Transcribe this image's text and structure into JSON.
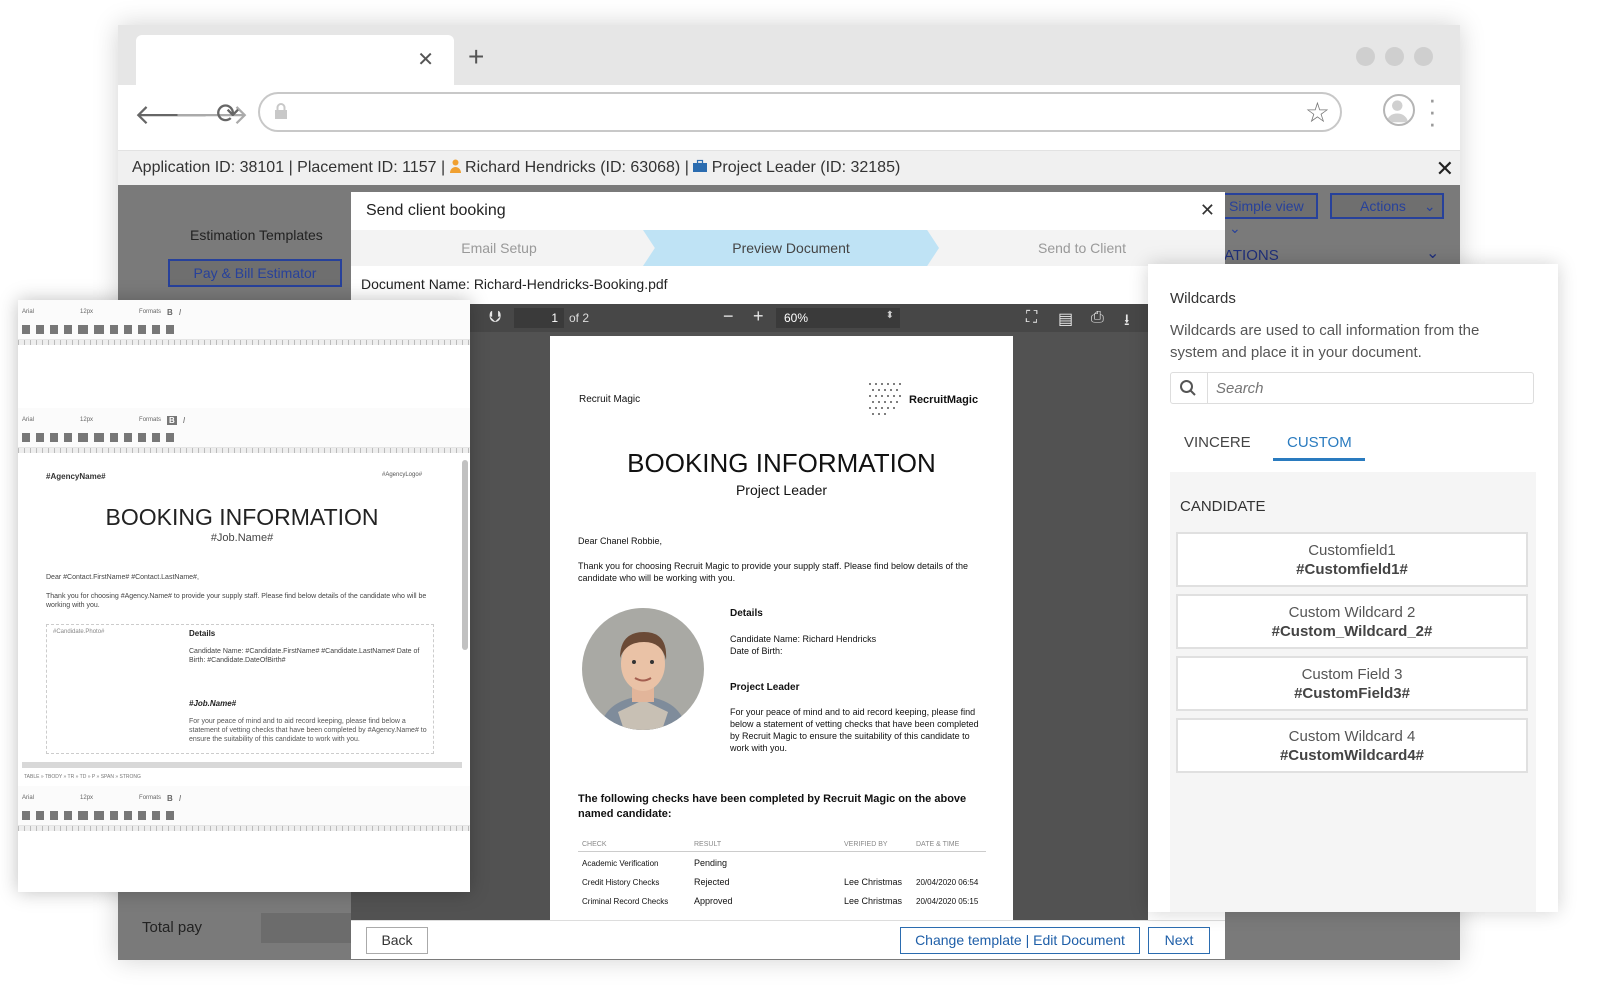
{
  "app": {
    "context_bar": {
      "application": "Application ID: 38101",
      "placement": "Placement ID: 1157",
      "candidate": "Richard Hendricks (ID: 63068)",
      "job": "Project Leader (ID: 32185)",
      "sep": "|"
    },
    "left": {
      "estimation_templates": "Estimation Templates",
      "pay_bill_estimator": "Pay & Bill Estimator",
      "total_pay": "Total pay"
    },
    "right": {
      "simple_view": "Simple view",
      "actions": "Actions",
      "section": "ATIONS"
    }
  },
  "modal": {
    "title": "Send client booking",
    "steps": [
      "Email Setup",
      "Preview Document",
      "Send to Client"
    ],
    "document_name": "Document Name: Richard-Hendricks-Booking.pdf",
    "viewer": {
      "page": "1",
      "page_of": "of 2",
      "zoom": "60%"
    },
    "footer": {
      "back": "Back",
      "change": "Change template | Edit Document",
      "next": "Next"
    }
  },
  "pdf": {
    "company": "Recruit Magic",
    "logo_text": "RecruitMagic",
    "title": "BOOKING INFORMATION",
    "subtitle": "Project Leader",
    "dear": "Dear Chanel Robbie,",
    "thanks": "Thank you for choosing Recruit Magic to provide your supply staff. Please find below details of the candidate who will be working with you.",
    "details_h": "Details",
    "details_name": "Candidate Name: Richard Hendricks",
    "details_dob": "Date of Birth:",
    "job_h": "Project Leader",
    "job_text": "For your peace of mind and to aid record keeping, please find below a statement of vetting checks that have been completed by Recruit Magic to ensure the suitability of this candidate to work with you.",
    "checks_h": "The following checks have been completed by Recruit Magic on the above named candidate:",
    "table": {
      "headers": [
        "CHECK",
        "RESULT",
        "VERIFIED BY",
        "DATE & TIME"
      ],
      "rows": [
        [
          "Academic Verification",
          "Pending",
          "",
          ""
        ],
        [
          "Credit History Checks",
          "Rejected",
          "Lee Christmas",
          "20/04/2020 06:54"
        ],
        [
          "Criminal Record Checks",
          "Approved",
          "Lee Christmas",
          "20/04/2020 05:15"
        ]
      ]
    }
  },
  "editor": {
    "font": "Arial",
    "size": "12px",
    "formats": "Formats",
    "agency_name": "#AgencyName#",
    "agency_logo": "#AgencyLogo#",
    "title": "BOOKING INFORMATION",
    "job_name": "#Job.Name#",
    "dear": "Dear #Contact.FirstName# #Contact.LastName#,",
    "thanks": "Thank you for choosing #Agency.Name# to provide your supply staff. Please find below details of the candidate who will be working with you.",
    "photo": "#Candidate.Photo#",
    "details": "Details",
    "cand_lines": "Candidate Name: #Candidate.FirstName# #Candidate.LastName# Date of Birth: #Candidate.DateOfBirth#",
    "job_named": "#Job.Name#",
    "peace": "For your peace of mind and to aid record keeping, please find below a statement of vetting checks that have been completed by #Agency.Name# to ensure the suitability of this candidate to work with you.",
    "status": "TABLE » TBODY » TR » TD » P » SPAN » STRONG"
  },
  "wildcards": {
    "title": "Wildcards",
    "description": "Wildcards are used to call information from the system and place it in your document.",
    "search_placeholder": "Search",
    "tabs": [
      "VINCERE",
      "CUSTOM"
    ],
    "active_tab": "CUSTOM",
    "section": "CANDIDATE",
    "items": [
      {
        "name": "Customfield1",
        "code": "#Customfield1#"
      },
      {
        "name": "Custom Wildcard 2",
        "code": "#Custom_Wildcard_2#"
      },
      {
        "name": "Custom Field 3",
        "code": "#CustomField3#"
      },
      {
        "name": "Custom Wildcard 4",
        "code": "#CustomWildcard4#"
      }
    ]
  },
  "colors": {
    "accent_blue": "#27419b",
    "active_step": "#bfe3f5",
    "link_blue": "#2a7bbf",
    "person_orange": "#f0a030",
    "job_blue": "#2b6cb0"
  },
  "icons": [
    "back-arrow-icon",
    "forward-arrow-icon",
    "reload-icon",
    "lock-icon",
    "star-icon",
    "profile-icon",
    "kebab-icon",
    "close-icon",
    "person-icon",
    "briefcase-icon",
    "chevron-down-icon",
    "search-icon",
    "fullscreen-icon",
    "print-icon",
    "download-icon"
  ]
}
